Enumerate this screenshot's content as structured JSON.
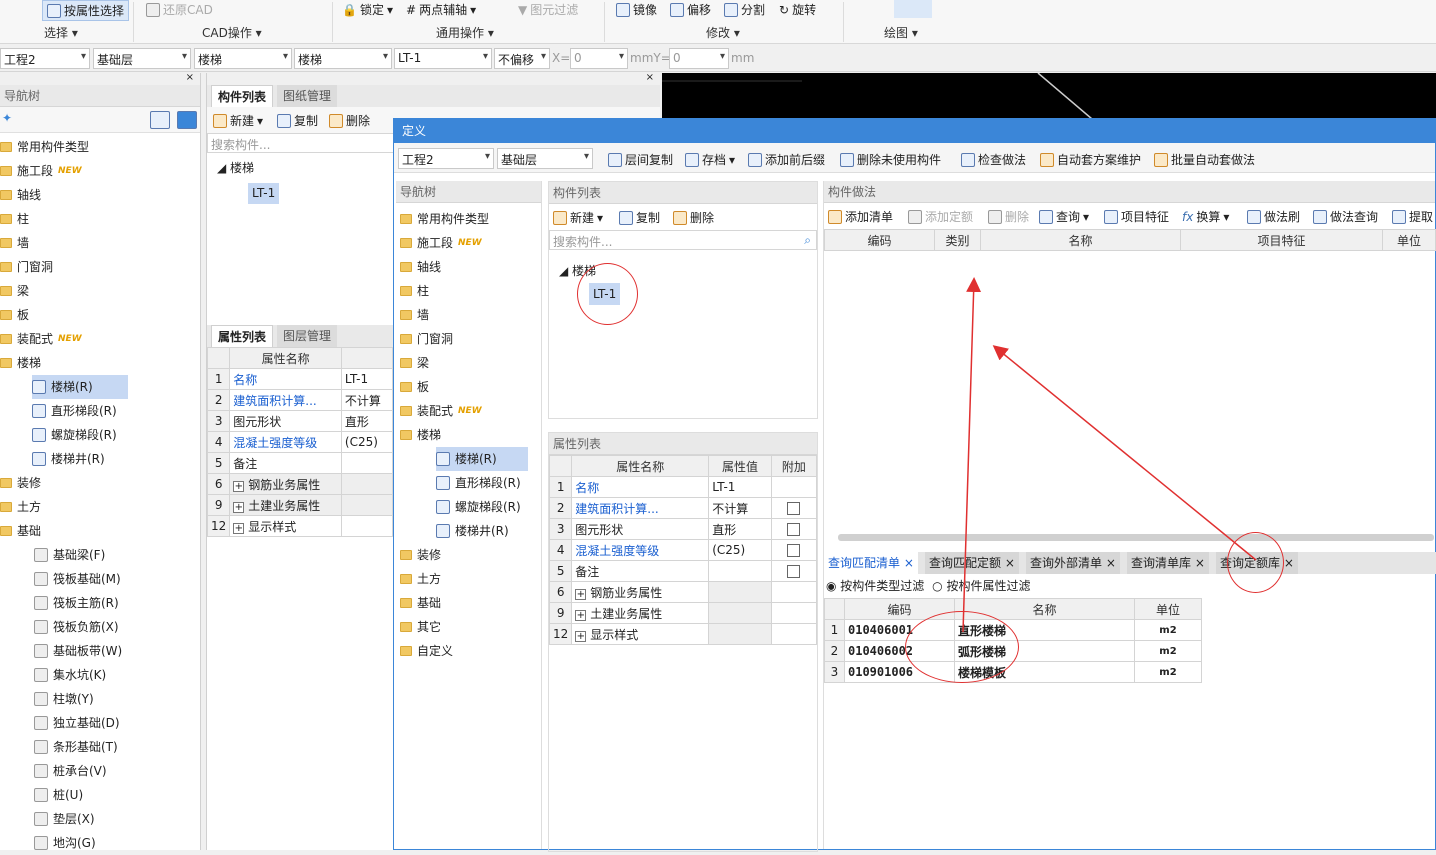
{
  "ribbon": {
    "items": [
      {
        "label": "按属性选择",
        "icon": "select-by-property-icon"
      },
      {
        "label": "还原CAD",
        "icon": "restore-cad-icon"
      },
      {
        "label": "锁定",
        "icon": "lock-icon"
      },
      {
        "label": "两点辅轴",
        "icon": "two-point-axis-icon"
      },
      {
        "label": "图元过滤",
        "icon": "filter-icon"
      },
      {
        "label": "镜像",
        "icon": "mirror-icon"
      },
      {
        "label": "偏移",
        "icon": "offset-icon"
      },
      {
        "label": "分割",
        "icon": "split-icon"
      },
      {
        "label": "旋转",
        "icon": "rotate-icon"
      }
    ],
    "groups": {
      "select": "选择",
      "cad": "CAD操作",
      "common": "通用操作",
      "modify": "修改",
      "draw": "绘图"
    }
  },
  "filter_bar": {
    "project": "工程2",
    "layer": "基础层",
    "type1": "楼梯",
    "type2": "楼梯",
    "item": "LT-1",
    "offset": "不偏移",
    "x_label": "X=",
    "x_value": "0",
    "mid_label": "mmY=",
    "y_value": "0",
    "unit": "mm"
  },
  "nav": {
    "title": "导航树",
    "items": [
      {
        "label": "常用构件类型"
      },
      {
        "label": "施工段",
        "new": "NEW"
      },
      {
        "label": "轴线"
      },
      {
        "label": "柱"
      },
      {
        "label": "墙"
      },
      {
        "label": "门窗洞"
      },
      {
        "label": "梁"
      },
      {
        "label": "板"
      },
      {
        "label": "装配式",
        "new": "NEW"
      },
      {
        "label": "楼梯"
      }
    ],
    "stair_children": [
      "楼梯(R)",
      "直形梯段(R)",
      "螺旋梯段(R)",
      "楼梯井(R)"
    ],
    "items2": [
      "装修",
      "土方",
      "基础"
    ],
    "foundation_children": [
      "基础梁(F)",
      "筏板基础(M)",
      "筏板主筋(R)",
      "筏板负筋(X)",
      "基础板带(W)",
      "集水坑(K)",
      "柱墩(Y)",
      "独立基础(D)",
      "条形基础(T)",
      "桩承台(V)",
      "桩(U)",
      "垫层(X)",
      "地沟(G)"
    ]
  },
  "left_comp": {
    "tabs": [
      "构件列表",
      "图纸管理"
    ],
    "buttons": [
      "新建",
      "复制",
      "删除"
    ],
    "search_placeholder": "搜索构件...",
    "tree_root": "楼梯",
    "tree_item": "LT-1"
  },
  "left_props": {
    "tabs": [
      "属性列表",
      "图层管理"
    ],
    "header": "属性名称",
    "rows": [
      {
        "n": "1",
        "name": "名称",
        "val": "LT-1",
        "blue": true
      },
      {
        "n": "2",
        "name": "建筑面积计算...",
        "val": "不计算",
        "blue": true
      },
      {
        "n": "3",
        "name": "图元形状",
        "val": "直形",
        "blue": false
      },
      {
        "n": "4",
        "name": "混凝土强度等级",
        "val": "(C25)",
        "blue": true
      },
      {
        "n": "5",
        "name": "备注",
        "val": "",
        "blue": false
      },
      {
        "n": "6",
        "name": "钢筋业务属性",
        "val": "",
        "plus": true
      },
      {
        "n": "9",
        "name": "土建业务属性",
        "val": "",
        "plus": true
      },
      {
        "n": "12",
        "name": "显示样式",
        "val": "",
        "plus": true
      }
    ]
  },
  "dialog": {
    "title": "定义",
    "project": "工程2",
    "layer": "基础层",
    "toolbar": [
      "层间复制",
      "存档",
      "添加前后缀",
      "删除未使用构件",
      "检查做法",
      "自动套方案维护",
      "批量自动套做法"
    ],
    "nav_title": "导航树",
    "nav_items": [
      {
        "label": "常用构件类型"
      },
      {
        "label": "施工段",
        "new": "NEW"
      },
      {
        "label": "轴线"
      },
      {
        "label": "柱"
      },
      {
        "label": "墙"
      },
      {
        "label": "门窗洞"
      },
      {
        "label": "梁"
      },
      {
        "label": "板"
      },
      {
        "label": "装配式",
        "new": "NEW"
      },
      {
        "label": "楼梯"
      }
    ],
    "stair_children": [
      "楼梯(R)",
      "直形梯段(R)",
      "螺旋梯段(R)",
      "楼梯井(R)"
    ],
    "nav_items2": [
      "装修",
      "土方",
      "基础",
      "其它",
      "自定义"
    ],
    "comp_title": "构件列表",
    "comp_buttons": [
      "新建",
      "复制",
      "删除"
    ],
    "search_placeholder": "搜索构件...",
    "tree_root": "楼梯",
    "tree_item": "LT-1",
    "prop_title": "属性列表",
    "prop_headers": [
      "属性名称",
      "属性值",
      "附加"
    ],
    "prop_rows": [
      {
        "n": "1",
        "name": "名称",
        "val": "LT-1",
        "blue": true,
        "chk": false
      },
      {
        "n": "2",
        "name": "建筑面积计算...",
        "val": "不计算",
        "blue": true,
        "chk": true
      },
      {
        "n": "3",
        "name": "图元形状",
        "val": "直形",
        "blue": false,
        "chk": true
      },
      {
        "n": "4",
        "name": "混凝土强度等级",
        "val": "(C25)",
        "blue": true,
        "chk": true
      },
      {
        "n": "5",
        "name": "备注",
        "val": "",
        "blue": false,
        "chk": true
      },
      {
        "n": "6",
        "name": "钢筋业务属性",
        "plus": true
      },
      {
        "n": "9",
        "name": "土建业务属性",
        "plus": true
      },
      {
        "n": "12",
        "name": "显示样式",
        "plus": true
      }
    ],
    "method_title": "构件做法",
    "method_buttons": [
      "添加清单",
      "添加定额",
      "删除",
      "查询",
      "项目特征",
      "换算",
      "做法刷",
      "做法查询",
      "提取"
    ],
    "method_headers": [
      "编码",
      "类别",
      "名称",
      "项目特征",
      "单位"
    ],
    "query_tabs": [
      "查询匹配清单",
      "查询匹配定额",
      "查询外部清单",
      "查询清单库",
      "查询定额库"
    ],
    "radio": [
      "按构件类型过滤",
      "按构件属性过滤"
    ],
    "result_headers": [
      "编码",
      "名称",
      "单位"
    ],
    "results": [
      {
        "n": "1",
        "code": "010406001",
        "name": "直形楼梯",
        "unit": "m2"
      },
      {
        "n": "2",
        "code": "010406002",
        "name": "弧形楼梯",
        "unit": "m2"
      },
      {
        "n": "3",
        "code": "010901006",
        "name": "楼梯模板",
        "unit": "m2"
      }
    ]
  },
  "colors": {
    "accent": "#3b86d8",
    "annotation": "#e03030"
  }
}
